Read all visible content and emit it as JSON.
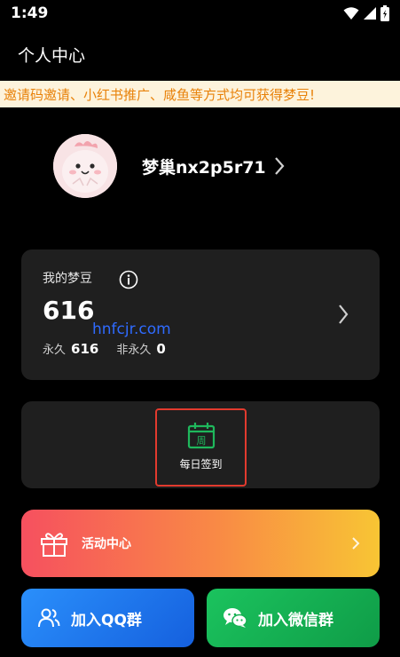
{
  "status_bar": {
    "time": "1:49",
    "icons": [
      "wifi-icon",
      "signal-icon",
      "battery-icon"
    ]
  },
  "header": {
    "title": "个人中心"
  },
  "banner": {
    "text": "邀请码邀请、小红书推广、咸鱼等方式均可获得梦豆!"
  },
  "profile": {
    "username": "梦巢nx2p5r71"
  },
  "beans": {
    "label": "我的梦豆",
    "total": "616",
    "permanent_label": "永久",
    "permanent_value": "616",
    "temporary_label": "非永久",
    "temporary_value": "0"
  },
  "watermark": "hnfcjr.com",
  "checkin": {
    "icon_text": "周",
    "label": "每日签到"
  },
  "activity": {
    "label": "活动中心"
  },
  "groups": {
    "qq_label": "加入QQ群",
    "wechat_label": "加入微信群"
  },
  "colors": {
    "banner_bg": "#fdf3dc",
    "banner_text": "#e8820a",
    "card_bg": "#1f1f1f",
    "checkin_green": "#1fb85c",
    "checkin_border": "#e23a2e",
    "qq_blue": "#1f7cf0",
    "wechat_green": "#16b052"
  }
}
